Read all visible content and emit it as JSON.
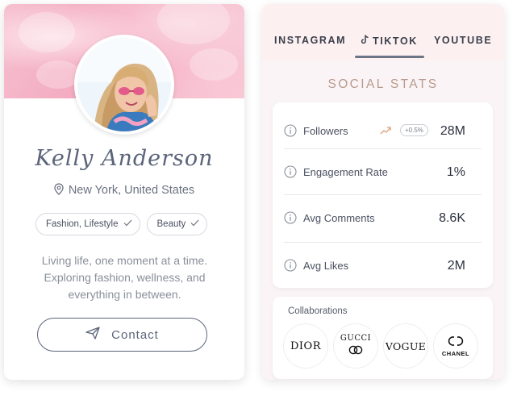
{
  "profile": {
    "name": "Kelly Anderson",
    "location": "New York, United States",
    "tags": [
      {
        "label": "Fashion, Lifestyle"
      },
      {
        "label": "Beauty"
      }
    ],
    "bio": "Living life, one moment at a time. Exploring fashion, wellness, and everything in between.",
    "contact_label": "Contact",
    "icons": {
      "location": "map-pin-icon",
      "tag_check": "check-icon",
      "contact": "send-icon"
    }
  },
  "tabs": [
    {
      "label": "INSTAGRAM",
      "active": false
    },
    {
      "label": "TIKTOK",
      "active": true,
      "icon": "tiktok-icon"
    },
    {
      "label": "YOUTUBE",
      "active": false
    }
  ],
  "stats": {
    "title": "SOCIAL STATS",
    "rows": [
      {
        "label": "Followers",
        "value": "28M",
        "badge": "+0.5%",
        "trend_icon": "trend-up-icon"
      },
      {
        "label": "Engagement Rate",
        "value": "1%"
      },
      {
        "label": "Avg Comments",
        "value": "8.6K"
      },
      {
        "label": "Avg Likes",
        "value": "2M"
      }
    ]
  },
  "collaborations": {
    "title": "Collaborations",
    "brands": [
      {
        "name": "DIOR"
      },
      {
        "name": "GUCCI"
      },
      {
        "name": "VOGUE"
      },
      {
        "name": "CHANEL"
      }
    ]
  },
  "colors": {
    "accent": "#5b6479",
    "stats_title": "#b89a8d",
    "tab_bg": "#fdf0f1",
    "trend": "#d9a27a"
  }
}
